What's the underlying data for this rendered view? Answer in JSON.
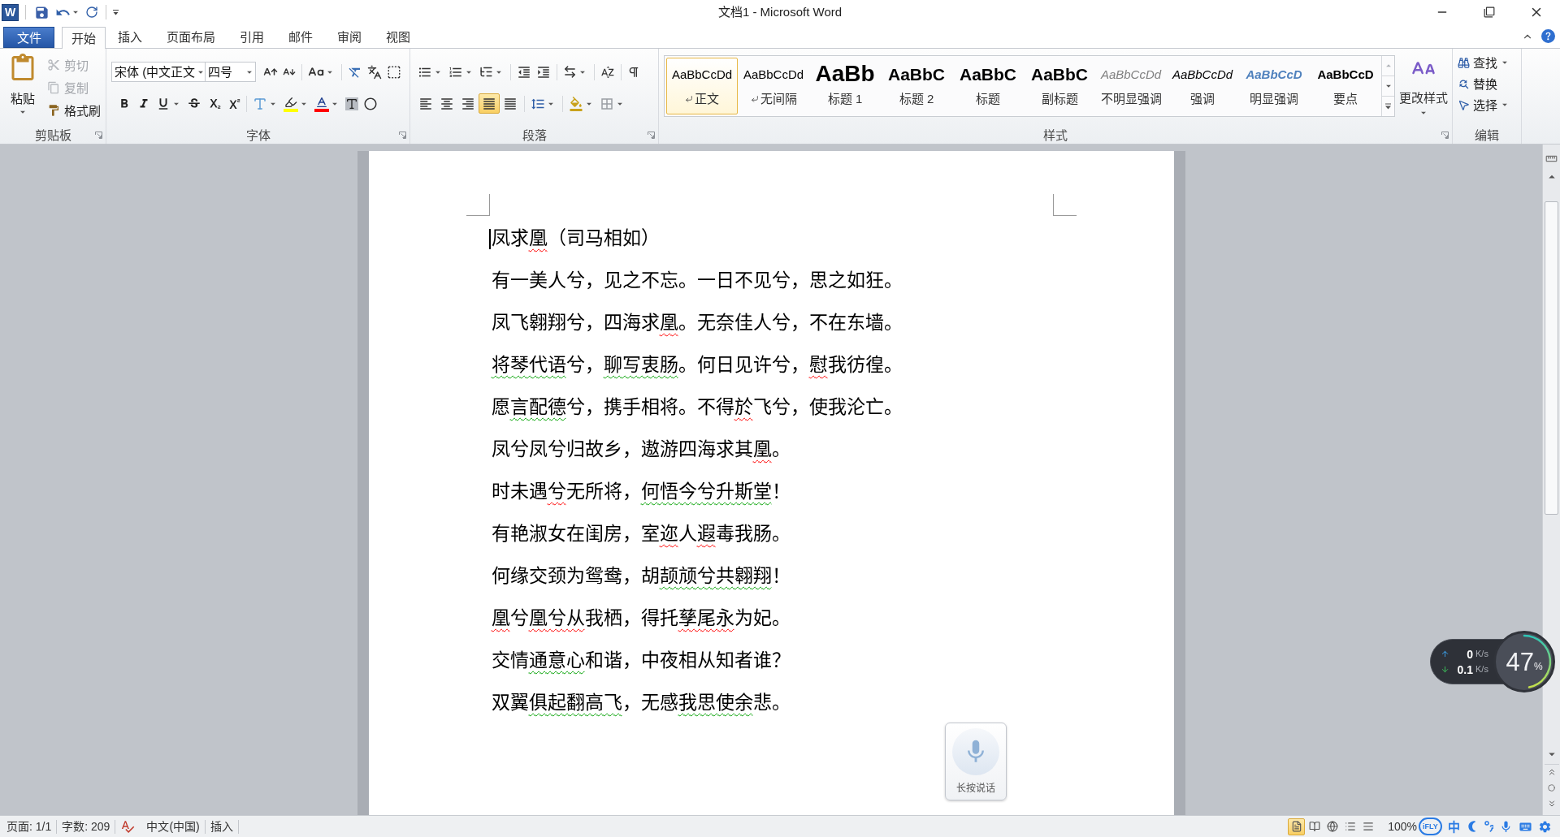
{
  "title_bar": {
    "logo": "W",
    "title": "文档1 - Microsoft Word"
  },
  "tabs": [
    {
      "label": "文件",
      "kind": "file",
      "selected": false
    },
    {
      "label": "开始",
      "kind": "tab",
      "selected": true
    },
    {
      "label": "插入",
      "kind": "tab",
      "selected": false
    },
    {
      "label": "页面布局",
      "kind": "tab",
      "selected": false
    },
    {
      "label": "引用",
      "kind": "tab",
      "selected": false
    },
    {
      "label": "邮件",
      "kind": "tab",
      "selected": false
    },
    {
      "label": "审阅",
      "kind": "tab",
      "selected": false
    },
    {
      "label": "视图",
      "kind": "tab",
      "selected": false
    }
  ],
  "clipboard": {
    "label": "剪贴板",
    "paste": "粘贴",
    "actions": [
      {
        "kind": "cut",
        "label": "剪切",
        "disabled": true
      },
      {
        "kind": "copy",
        "label": "复制",
        "disabled": true
      },
      {
        "kind": "format_painter",
        "label": "格式刷",
        "disabled": false
      }
    ]
  },
  "font": {
    "label": "字体",
    "font_name": "宋体 (中文正文",
    "font_size": "四号"
  },
  "paragraph": {
    "label": "段落",
    "alignments": [
      {
        "kind": "left",
        "selected": false
      },
      {
        "kind": "center",
        "selected": false
      },
      {
        "kind": "right",
        "selected": false
      },
      {
        "kind": "justify",
        "selected": true
      },
      {
        "kind": "distributed",
        "selected": false
      }
    ]
  },
  "styles": {
    "label": "样式",
    "change_styles": "更改样式",
    "items": [
      {
        "kind": "normal",
        "preview": "AaBbCcDd",
        "name": "正文",
        "paragraph_mark": true,
        "selected": true
      },
      {
        "kind": "no_spacing",
        "preview": "AaBbCcDd",
        "name": "无间隔",
        "paragraph_mark": true,
        "selected": false
      },
      {
        "kind": "heading1",
        "preview": "AaBb",
        "name": "标题 1",
        "paragraph_mark": false,
        "selected": false
      },
      {
        "kind": "heading2",
        "preview": "AaBbC",
        "name": "标题 2",
        "paragraph_mark": false,
        "selected": false
      },
      {
        "kind": "title",
        "preview": "AaBbC",
        "name": "标题",
        "paragraph_mark": false,
        "selected": false
      },
      {
        "kind": "subtitle",
        "preview": "AaBbC",
        "name": "副标题",
        "paragraph_mark": false,
        "selected": false
      },
      {
        "kind": "subtle_emphasis",
        "preview": "AaBbCcDd",
        "name": "不明显强调",
        "paragraph_mark": false,
        "selected": false
      },
      {
        "kind": "emphasis",
        "preview": "AaBbCcDd",
        "name": "强调",
        "paragraph_mark": false,
        "selected": false
      },
      {
        "kind": "intense_emphasis",
        "preview": "AaBbCcD",
        "name": "明显强调",
        "paragraph_mark": false,
        "selected": false
      },
      {
        "kind": "strong",
        "preview": "AaBbCcD",
        "name": "要点",
        "paragraph_mark": false,
        "selected": false
      }
    ]
  },
  "editing": {
    "label": "编辑",
    "items": [
      {
        "kind": "find",
        "label": "查找",
        "dropdown": true
      },
      {
        "kind": "replace",
        "label": "替换",
        "dropdown": false
      },
      {
        "kind": "select",
        "label": "选择",
        "dropdown": true
      }
    ]
  },
  "document": {
    "lines": [
      {
        "segments": [
          {
            "text": "凤求",
            "spelling_error": false,
            "grammar_error": false
          },
          {
            "text": "凰",
            "spelling_error": true,
            "grammar_error": false
          },
          {
            "text": "（司马相如）",
            "spelling_error": false,
            "grammar_error": false
          }
        ]
      },
      {
        "segments": [
          {
            "text": "有一美人兮，见之不忘。一日不见兮，思之如狂。",
            "spelling_error": false,
            "grammar_error": false
          }
        ]
      },
      {
        "segments": [
          {
            "text": "凤飞翱翔兮，四海求",
            "spelling_error": false,
            "grammar_error": false
          },
          {
            "text": "凰",
            "spelling_error": true,
            "grammar_error": false
          },
          {
            "text": "。无奈佳人兮，不在东墙。",
            "spelling_error": false,
            "grammar_error": false
          }
        ]
      },
      {
        "segments": [
          {
            "text": "将琴代语",
            "spelling_error": false,
            "grammar_error": true
          },
          {
            "text": "兮，",
            "spelling_error": false,
            "grammar_error": false
          },
          {
            "text": "聊写衷肠",
            "spelling_error": false,
            "grammar_error": true
          },
          {
            "text": "。何日见许兮，",
            "spelling_error": false,
            "grammar_error": false
          },
          {
            "text": "慰",
            "spelling_error": true,
            "grammar_error": false
          },
          {
            "text": "我彷徨。",
            "spelling_error": false,
            "grammar_error": false
          }
        ]
      },
      {
        "segments": [
          {
            "text": "愿",
            "spelling_error": false,
            "grammar_error": false
          },
          {
            "text": "言配德",
            "spelling_error": false,
            "grammar_error": true
          },
          {
            "text": "兮，携手相将。不得",
            "spelling_error": false,
            "grammar_error": false
          },
          {
            "text": "於",
            "spelling_error": true,
            "grammar_error": false
          },
          {
            "text": "飞兮，使我沦亡。",
            "spelling_error": false,
            "grammar_error": false
          }
        ]
      },
      {
        "segments": [
          {
            "text": "凤兮凤兮归故乡，遨游四海求其",
            "spelling_error": false,
            "grammar_error": false
          },
          {
            "text": "凰",
            "spelling_error": true,
            "grammar_error": false
          },
          {
            "text": "。",
            "spelling_error": false,
            "grammar_error": false
          }
        ]
      },
      {
        "segments": [
          {
            "text": "时未遇",
            "spelling_error": false,
            "grammar_error": false
          },
          {
            "text": "兮",
            "spelling_error": true,
            "grammar_error": false
          },
          {
            "text": "无所将，",
            "spelling_error": false,
            "grammar_error": false
          },
          {
            "text": "何悟今兮升斯堂",
            "spelling_error": false,
            "grammar_error": true
          },
          {
            "text": "！",
            "spelling_error": false,
            "grammar_error": false
          }
        ]
      },
      {
        "segments": [
          {
            "text": "有艳淑女在闺房，室",
            "spelling_error": false,
            "grammar_error": false
          },
          {
            "text": "迩",
            "spelling_error": true,
            "grammar_error": false
          },
          {
            "text": "人",
            "spelling_error": false,
            "grammar_error": false
          },
          {
            "text": "遐",
            "spelling_error": true,
            "grammar_error": false
          },
          {
            "text": "毒我肠。",
            "spelling_error": false,
            "grammar_error": false
          }
        ]
      },
      {
        "segments": [
          {
            "text": "何缘交颈为鸳鸯，胡",
            "spelling_error": false,
            "grammar_error": false
          },
          {
            "text": "颉颃兮共翱翔",
            "spelling_error": false,
            "grammar_error": true
          },
          {
            "text": "！",
            "spelling_error": false,
            "grammar_error": false
          }
        ]
      },
      {
        "segments": [
          {
            "text": "凰",
            "spelling_error": true,
            "grammar_error": false
          },
          {
            "text": "兮",
            "spelling_error": false,
            "grammar_error": false
          },
          {
            "text": "凰兮从",
            "spelling_error": true,
            "grammar_error": false
          },
          {
            "text": "我栖，得托",
            "spelling_error": false,
            "grammar_error": false
          },
          {
            "text": "孳尾永",
            "spelling_error": true,
            "grammar_error": false
          },
          {
            "text": "为妃。",
            "spelling_error": false,
            "grammar_error": false
          }
        ]
      },
      {
        "segments": [
          {
            "text": "交情",
            "spelling_error": false,
            "grammar_error": false
          },
          {
            "text": "通意心",
            "spelling_error": false,
            "grammar_error": true
          },
          {
            "text": "和谐，中夜相从知者谁？",
            "spelling_error": false,
            "grammar_error": false
          }
        ]
      },
      {
        "segments": [
          {
            "text": "双翼",
            "spelling_error": false,
            "grammar_error": false
          },
          {
            "text": "俱起翻高飞",
            "spelling_error": false,
            "grammar_error": true
          },
          {
            "text": "，无感",
            "spelling_error": false,
            "grammar_error": false
          },
          {
            "text": "我思使余",
            "spelling_error": false,
            "grammar_error": true
          },
          {
            "text": "悲。",
            "spelling_error": false,
            "grammar_error": false
          }
        ]
      }
    ]
  },
  "status_bar": {
    "page": "页面: 1/1",
    "word_count": "字数: 209",
    "language": "中文(中国)",
    "mode": "插入",
    "views": [
      {
        "kind": "print_layout",
        "selected": true
      },
      {
        "kind": "reading",
        "selected": false
      },
      {
        "kind": "web",
        "selected": false
      },
      {
        "kind": "outline",
        "selected": false
      },
      {
        "kind": "draft",
        "selected": false
      }
    ],
    "zoom": "100%"
  },
  "ime_toolbar": {
    "logo": "iFLY",
    "mode": "中"
  },
  "network_widget": {
    "upload": "0",
    "upload_unit": "K/s",
    "download": "0.1",
    "download_unit": "K/s",
    "usage": "47",
    "usage_unit": "%",
    "level": 0.47
  },
  "voice_input": {
    "label": "长按说话"
  }
}
